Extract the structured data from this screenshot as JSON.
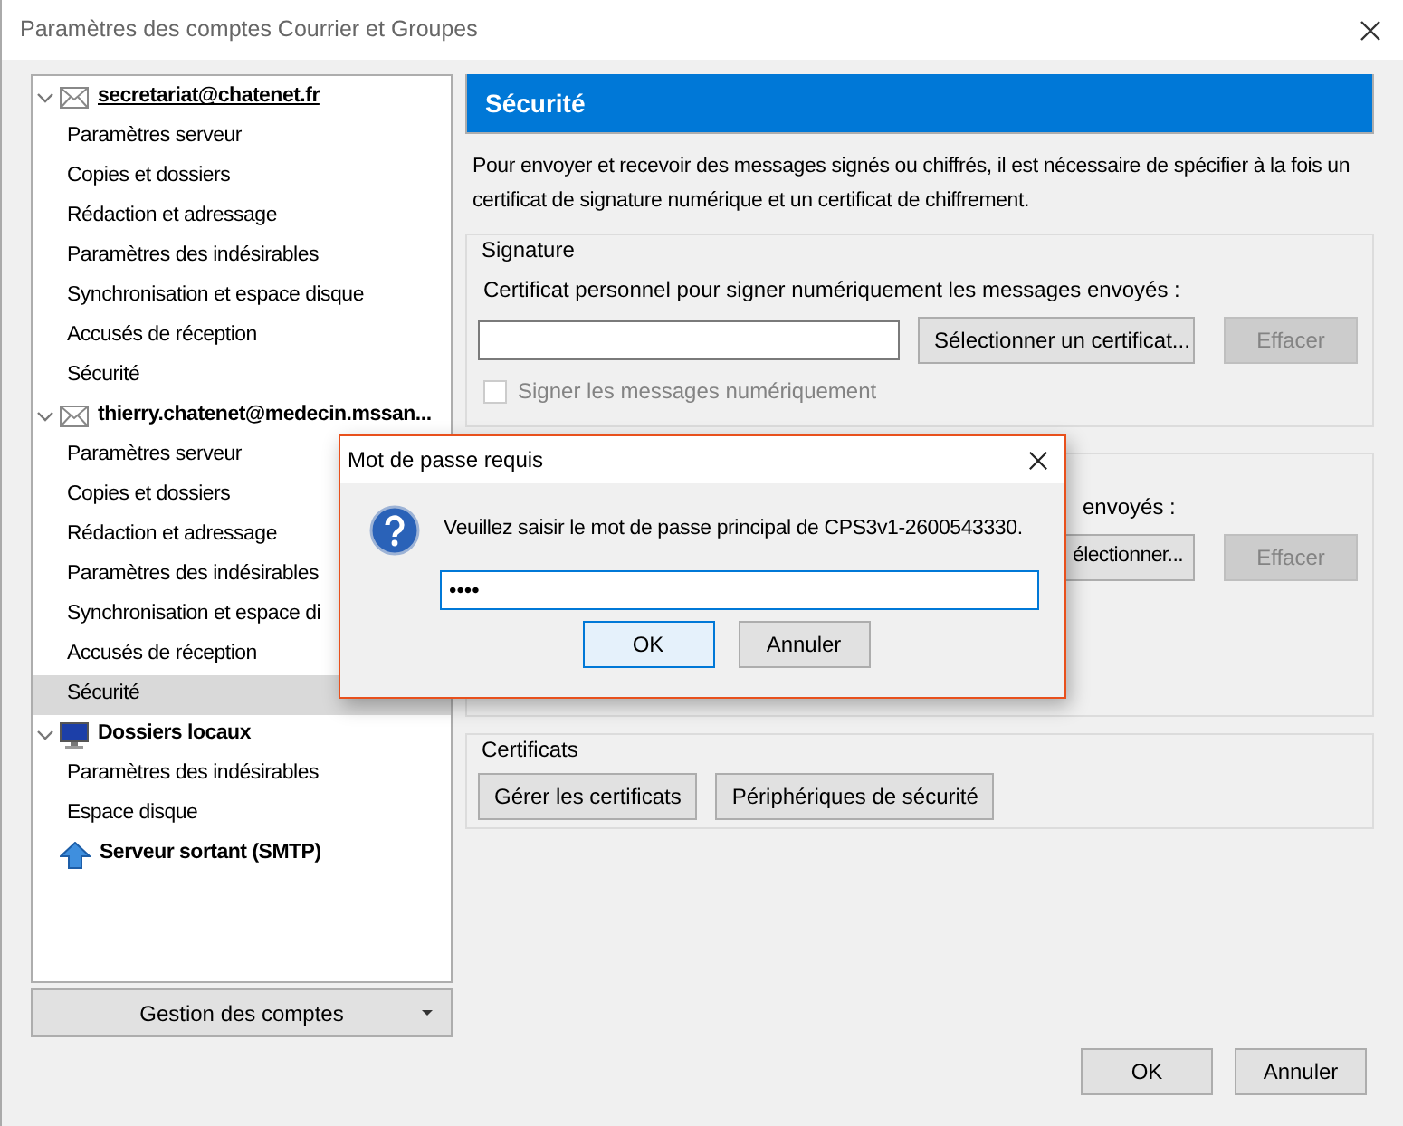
{
  "window": {
    "title": "Paramètres des comptes Courrier et Groupes"
  },
  "tree": [
    {
      "label": "secretariat@chatenet.fr",
      "kind": "mail",
      "expanded": true,
      "focused": true,
      "selected": false,
      "children": [
        {
          "label": "Paramètres serveur",
          "selected": false
        },
        {
          "label": "Copies et dossiers",
          "selected": false
        },
        {
          "label": "Rédaction et adressage",
          "selected": false
        },
        {
          "label": "Paramètres des indésirables",
          "selected": false
        },
        {
          "label": "Synchronisation et espace disque",
          "selected": false
        },
        {
          "label": "Accusés de réception",
          "selected": false
        },
        {
          "label": "Sécurité",
          "selected": false
        }
      ]
    },
    {
      "label": "thierry.chatenet@medecin.mssan...",
      "kind": "mail",
      "expanded": true,
      "focused": false,
      "selected": false,
      "children": [
        {
          "label": "Paramètres serveur",
          "selected": false
        },
        {
          "label": "Copies et dossiers",
          "selected": false
        },
        {
          "label": "Rédaction et adressage",
          "selected": false
        },
        {
          "label": "Paramètres des indésirables",
          "selected": false
        },
        {
          "label": "Synchronisation et espace di",
          "selected": false
        },
        {
          "label": "Accusés de réception",
          "selected": false
        },
        {
          "label": "Sécurité",
          "selected": true
        }
      ]
    },
    {
      "label": "Dossiers locaux",
      "kind": "local",
      "expanded": true,
      "focused": false,
      "selected": false,
      "children": [
        {
          "label": "Paramètres des indésirables",
          "selected": false
        },
        {
          "label": "Espace disque",
          "selected": false
        }
      ]
    },
    {
      "label": "Serveur sortant (SMTP)",
      "kind": "smtp",
      "focused": false,
      "selected": false
    }
  ],
  "account_menu_button": "Gestion des comptes",
  "panel": {
    "header": "Sécurité",
    "description": "Pour envoyer et recevoir des messages signés ou chiffrés, il est nécessaire de spécifier à la fois un certificat de signature numérique et un certificat de chiffrement.",
    "signature": {
      "legend": "Signature",
      "label": "Certificat personnel pour signer numériquement les messages envoyés :",
      "select_button": "Sélectionner un certificat...",
      "clear_button": {
        "label": "Effacer",
        "disabled": true
      },
      "checkbox": {
        "label": "Signer les messages numériquement",
        "checked": false,
        "disabled": true
      }
    },
    "encryption": {
      "label": "envoyés :",
      "select_button": "électionner...",
      "clear_button": {
        "label": "Effacer",
        "disabled": true
      }
    },
    "certificates": {
      "legend": "Certificats",
      "buttons": [
        "Gérer les certificats",
        "Périphériques de sécurité"
      ]
    }
  },
  "footer_buttons": [
    "OK",
    "Annuler"
  ],
  "dialog": {
    "title": "Mot de passe requis",
    "message": "Veuillez saisir le mot de passe principal de CPS3v1-2600543330.",
    "password": "••••",
    "buttons": [
      {
        "label": "OK",
        "default": true
      },
      {
        "label": "Annuler",
        "default": false
      }
    ]
  }
}
